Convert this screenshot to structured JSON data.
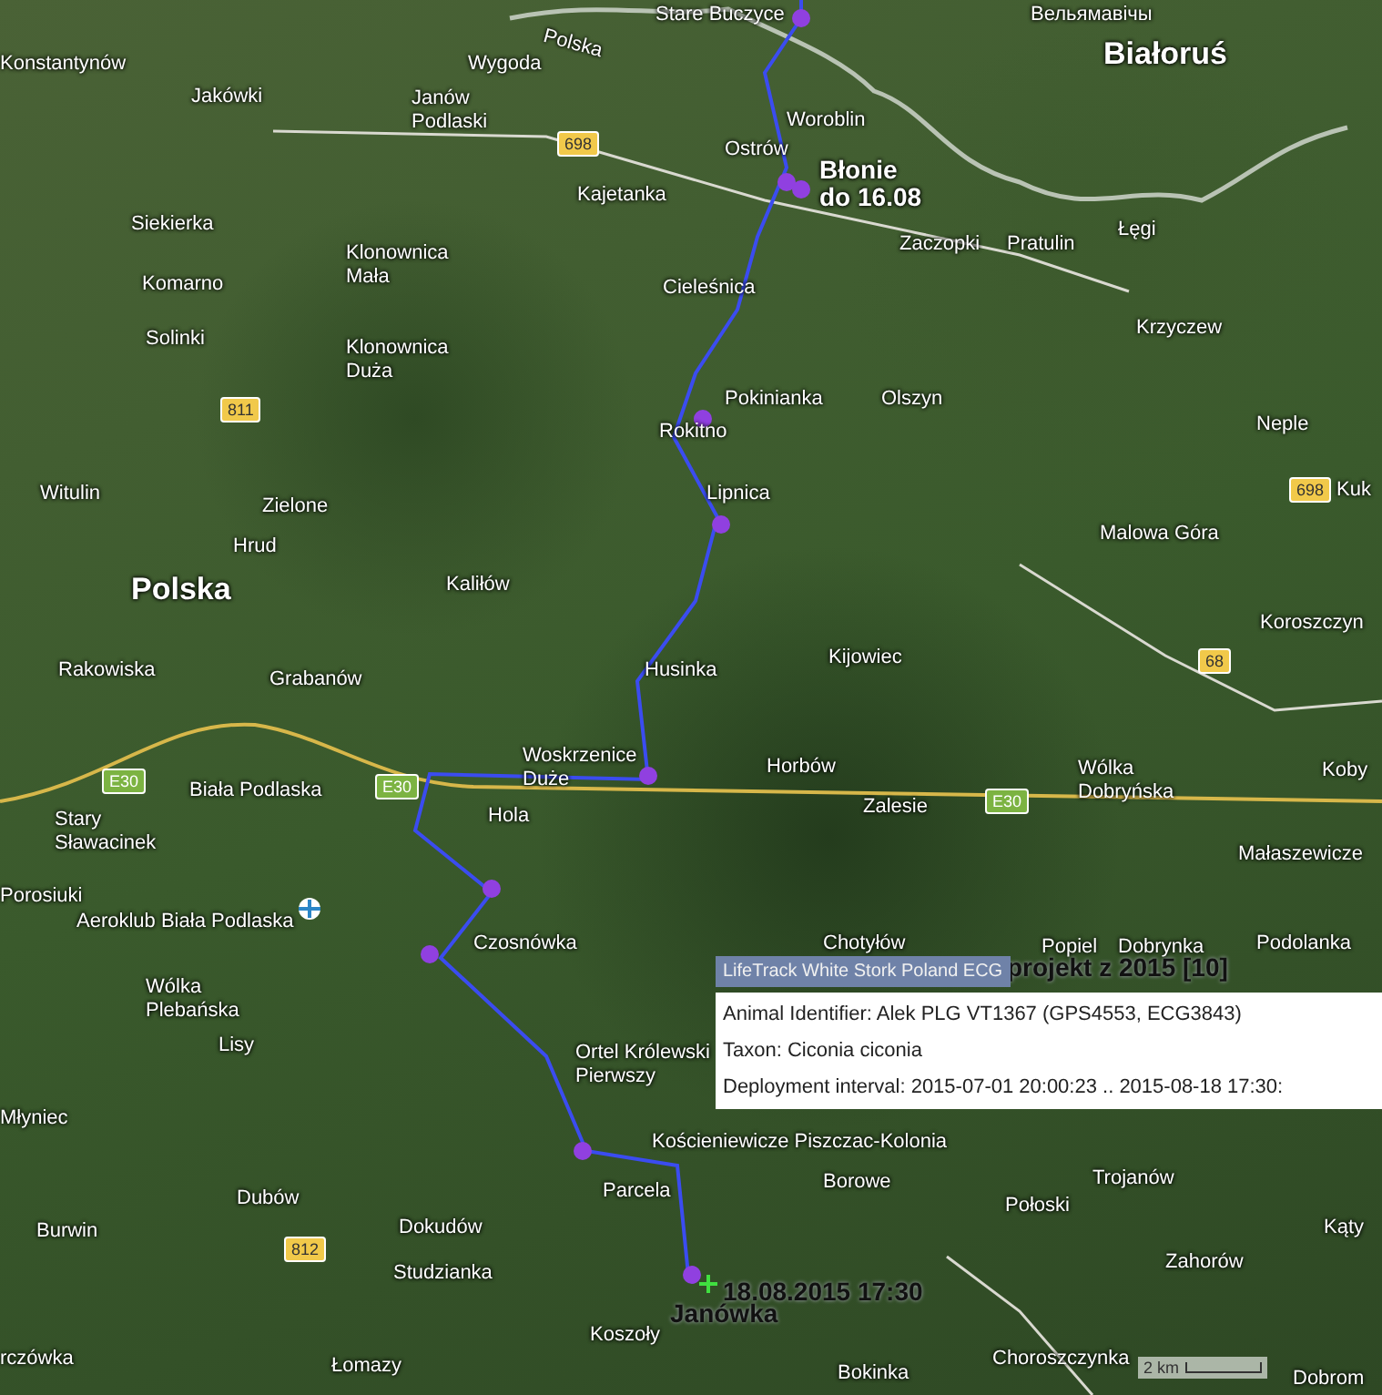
{
  "map": {
    "countries": [
      "Białoruś",
      "Polska"
    ],
    "places": [
      "Stare Buczyce",
      "Вельямавічы",
      "Polska",
      "Konstantynów",
      "Wygoda",
      "Jakówki",
      "Janów Podlaski",
      "Woroblin",
      "Ostrów",
      "Kajetanka",
      "Siekierka",
      "Łęgi",
      "Zaczopki",
      "Pratulin",
      "Klonownica Mała",
      "Komarno",
      "Cieleśnica",
      "Krzyczew",
      "Solinki",
      "Klonownica Duża",
      "Pokinianka",
      "Olszyn",
      "Neple",
      "Rokitno",
      "Witulin",
      "Lipnica",
      "Kuk",
      "Zielone",
      "Malowa Góra",
      "Hrud",
      "Kaliłów",
      "Koroszczyn",
      "Kijowiec",
      "Rakowiska",
      "Grabanów",
      "Husinka",
      "Woskrzenice Duże",
      "Horbów",
      "Wólka Dobryńska",
      "Koby",
      "Stary Sławacinek",
      "Biała Podlaska",
      "Hola",
      "Zalesie",
      "Małaszewicze",
      "Porosiuki",
      "Aeroklub Biała Podlaska",
      "Czosnówka",
      "Chotyłów",
      "Popiel",
      "Dobrynka",
      "Podolanka",
      "Wólka Plebańska",
      "Lisy",
      "Ortel Królewski Pierwszy",
      "Młyniec",
      "Kościeniewicze Piszczac-Kolonia",
      "Dubów",
      "Parcela",
      "Borowe",
      "Połoski",
      "Trojanów",
      "Burwin",
      "Dokudów",
      "Kąty",
      "Zahorów",
      "Studzianka",
      "Koszoły",
      "rczówka",
      "Łomazy",
      "Bokinka",
      "Choroszczynka",
      "Dobrom"
    ],
    "road_numbers": [
      "698",
      "811",
      "698",
      "68",
      "E30",
      "E30",
      "E30",
      "812"
    ],
    "track_labels": [
      {
        "text": "Błonie do 16.08",
        "color": "#ffffff"
      },
      {
        "text": "18.08.2015 17:30",
        "color": "#111111"
      },
      {
        "text": "Janówka",
        "color": "#111111"
      },
      {
        "text": "projekt z 2015 [10]",
        "color": "#111111"
      }
    ],
    "popup": {
      "header": "LifeTrack White Stork Poland ECG",
      "lines": [
        "Animal Identifier: Alek PLG VT1367 (GPS4553, ECG3843)",
        "Taxon: Ciconia ciconia",
        "Deployment interval: 2015-07-01 20:00:23 .. 2015-08-18 17:30:"
      ]
    },
    "scale": {
      "label": "2 km"
    }
  }
}
